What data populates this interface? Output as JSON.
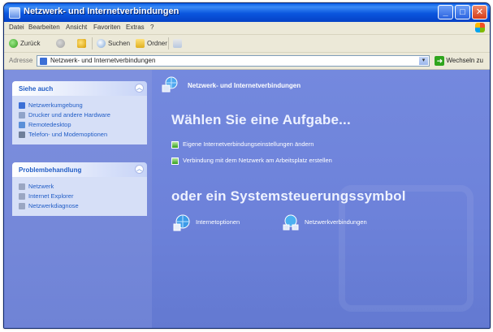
{
  "window": {
    "title": "Netzwerk- und Internetverbindungen",
    "buttons": {
      "minimize": "_",
      "maximize": "□",
      "close": "✕"
    }
  },
  "menubar": {
    "items": [
      "Datei",
      "Bearbeiten",
      "Ansicht",
      "Favoriten",
      "Extras",
      "?"
    ]
  },
  "toolbar": {
    "back": "Zurück",
    "forward": "",
    "up": "",
    "search": "Suchen",
    "folders": "Ordner",
    "views": ""
  },
  "addressbar": {
    "label": "Adresse",
    "value": "Netzwerk- und Internetverbindungen",
    "go_label": "Wechseln zu"
  },
  "tasks_panel": {
    "see_also": {
      "title": "Siehe auch",
      "items": [
        "Netzwerkumgebung",
        "Drucker und andere Hardware",
        "Remotedesktop",
        "Telefon- und Modemoptionen"
      ]
    },
    "troubleshoot": {
      "title": "Problembehandlung",
      "items": [
        "Netzwerk",
        "Internet Explorer",
        "Netzwerkdiagnose"
      ]
    }
  },
  "main": {
    "header": "Netzwerk- und Internetverbindungen",
    "pick_task": "Wählen Sie eine Aufgabe...",
    "tasks": [
      "Eigene Internetverbindungseinstellungen ändern",
      "Verbindung mit dem Netzwerk am Arbeitsplatz erstellen"
    ],
    "or_pick_icon": "oder ein Systemsteuerungssymbol",
    "icons": [
      {
        "label": "Internetoptionen",
        "icon": "internet-options-icon"
      },
      {
        "label": "Netzwerkverbindungen",
        "icon": "network-connections-icon"
      }
    ]
  },
  "colors": {
    "titlebar": "#0a55de",
    "content_bg": "#6d82da",
    "taskbox_body": "#d6dff7",
    "link_blue": "#215dc6"
  }
}
